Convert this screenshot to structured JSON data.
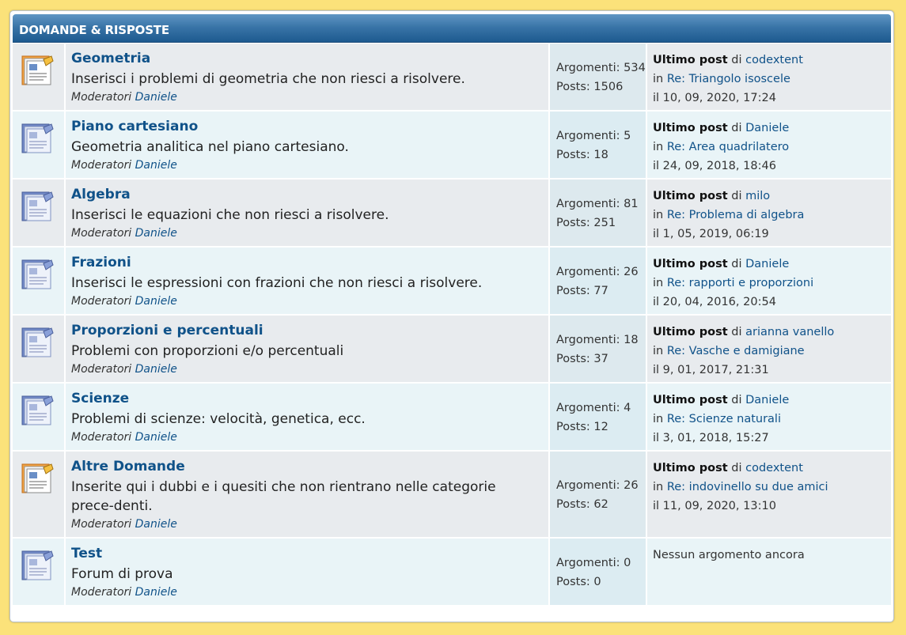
{
  "category": {
    "title": "DOMANDE & RISPOSTE"
  },
  "labels": {
    "topics": "Argomenti:",
    "posts": "Posts:",
    "moderators": "Moderatori",
    "last_post": "Ultimo post",
    "by": "di",
    "in": "in",
    "on": "il",
    "no_topics": "Nessun argomento ancora"
  },
  "forums": [
    {
      "title": "Geometria",
      "desc": "Inserisci i problemi di geometria che non riesci a risolvere.",
      "moderator": "Daniele",
      "topics": "534",
      "posts": "1506",
      "last_author": "codextent",
      "last_topic": "Re: Triangolo isoscele",
      "last_date": "10, 09, 2020, 17:24",
      "icon": "forum-read-icon"
    },
    {
      "title": "Piano cartesiano",
      "desc": "Geometria analitica nel piano cartesiano.",
      "moderator": "Daniele",
      "topics": "5",
      "posts": "18",
      "last_author": "Daniele",
      "last_topic": "Re: Area quadrilatero",
      "last_date": "24, 09, 2018, 18:46",
      "icon": "forum-icon"
    },
    {
      "title": "Algebra",
      "desc": "Inserisci le equazioni che non riesci a risolvere.",
      "moderator": "Daniele",
      "topics": "81",
      "posts": "251",
      "last_author": "milo",
      "last_topic": "Re: Problema di algebra",
      "last_date": "1, 05, 2019, 06:19",
      "icon": "forum-icon"
    },
    {
      "title": "Frazioni",
      "desc": "Inserisci le espressioni con frazioni che non riesci a risolvere.",
      "moderator": "Daniele",
      "topics": "26",
      "posts": "77",
      "last_author": "Daniele",
      "last_topic": "Re: rapporti e proporzioni",
      "last_date": "20, 04, 2016, 20:54",
      "icon": "forum-icon"
    },
    {
      "title": "Proporzioni e percentuali",
      "desc": "Problemi con proporzioni e/o percentuali",
      "moderator": "Daniele",
      "topics": "18",
      "posts": "37",
      "last_author": "arianna vanello",
      "last_topic": "Re: Vasche e damigiane",
      "last_date": "9, 01, 2017, 21:31",
      "icon": "forum-icon"
    },
    {
      "title": "Scienze",
      "desc": "Problemi di scienze: velocità, genetica, ecc.",
      "moderator": "Daniele",
      "topics": "4",
      "posts": "12",
      "last_author": "Daniele",
      "last_topic": "Re: Scienze naturali",
      "last_date": "3, 01, 2018, 15:27",
      "icon": "forum-icon"
    },
    {
      "title": "Altre Domande",
      "desc": "Inserite qui i dubbi e i quesiti che non rientrano nelle categorie prece-denti.",
      "moderator": "Daniele",
      "topics": "26",
      "posts": "62",
      "last_author": "codextent",
      "last_topic": "Re: indovinello su due amici",
      "last_date": "11, 09, 2020, 13:10",
      "icon": "forum-read-icon"
    },
    {
      "title": "Test",
      "desc": "Forum di prova",
      "moderator": "Daniele",
      "topics": "0",
      "posts": "0",
      "last_author": "",
      "last_topic": "",
      "last_date": "",
      "icon": "forum-icon"
    }
  ],
  "colors": {
    "link": "#105289",
    "header": "#2a6aa0",
    "background": "#fbe27a"
  }
}
